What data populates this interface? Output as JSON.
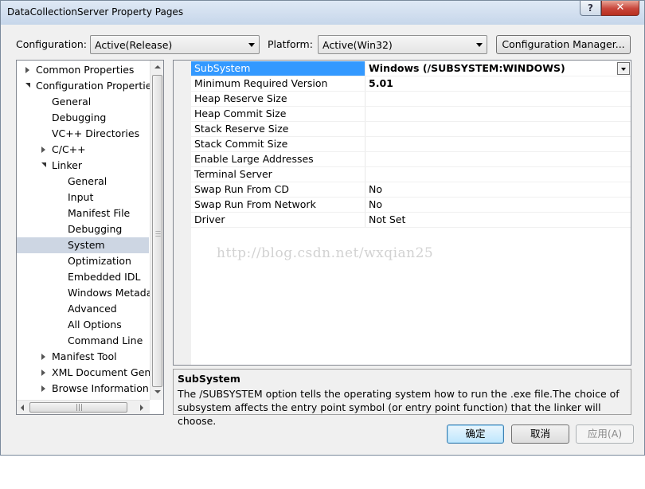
{
  "window": {
    "title": "DataCollectionServer Property Pages",
    "help_glyph": "?",
    "close_glyph": "✕"
  },
  "toolbar": {
    "configuration_label": "Configuration:",
    "configuration_value": "Active(Release)",
    "platform_label": "Platform:",
    "platform_value": "Active(Win32)",
    "config_manager_label": "Configuration Manager..."
  },
  "tree": {
    "items": [
      {
        "label": "Common Properties",
        "expander": "closed"
      },
      {
        "label": "Configuration Properties",
        "expander": "open"
      },
      {
        "label": "General",
        "expander": "none"
      },
      {
        "label": "Debugging",
        "expander": "none"
      },
      {
        "label": "VC++ Directories",
        "expander": "none"
      },
      {
        "label": "C/C++",
        "expander": "closed"
      },
      {
        "label": "Linker",
        "expander": "open"
      },
      {
        "label": "General",
        "expander": "none"
      },
      {
        "label": "Input",
        "expander": "none"
      },
      {
        "label": "Manifest File",
        "expander": "none"
      },
      {
        "label": "Debugging",
        "expander": "none"
      },
      {
        "label": "System",
        "expander": "none",
        "selected": true
      },
      {
        "label": "Optimization",
        "expander": "none"
      },
      {
        "label": "Embedded IDL",
        "expander": "none"
      },
      {
        "label": "Windows Metadata",
        "expander": "none"
      },
      {
        "label": "Advanced",
        "expander": "none"
      },
      {
        "label": "All Options",
        "expander": "none"
      },
      {
        "label": "Command Line",
        "expander": "none"
      },
      {
        "label": "Manifest Tool",
        "expander": "closed"
      },
      {
        "label": "XML Document Generator",
        "expander": "closed"
      },
      {
        "label": "Browse Information",
        "expander": "closed"
      }
    ]
  },
  "grid": {
    "rows": [
      {
        "name": "SubSystem",
        "value": "Windows (/SUBSYSTEM:WINDOWS)",
        "bold": true,
        "selected": true
      },
      {
        "name": "Minimum Required Version",
        "value": "5.01",
        "bold": true
      },
      {
        "name": "Heap Reserve Size",
        "value": ""
      },
      {
        "name": "Heap Commit Size",
        "value": ""
      },
      {
        "name": "Stack Reserve Size",
        "value": ""
      },
      {
        "name": "Stack Commit Size",
        "value": ""
      },
      {
        "name": "Enable Large Addresses",
        "value": ""
      },
      {
        "name": "Terminal Server",
        "value": ""
      },
      {
        "name": "Swap Run From CD",
        "value": "No"
      },
      {
        "name": "Swap Run From Network",
        "value": "No"
      },
      {
        "name": "Driver",
        "value": "Not Set"
      }
    ]
  },
  "watermark": "http://blog.csdn.net/wxqian25",
  "description": {
    "title": "SubSystem",
    "text": "The /SUBSYSTEM option tells the operating system how to run the .exe file.The choice of subsystem affects the entry point symbol (or entry point function) that the linker will choose."
  },
  "buttons": {
    "ok": "确定",
    "cancel": "取消",
    "apply": "应用(A)"
  }
}
